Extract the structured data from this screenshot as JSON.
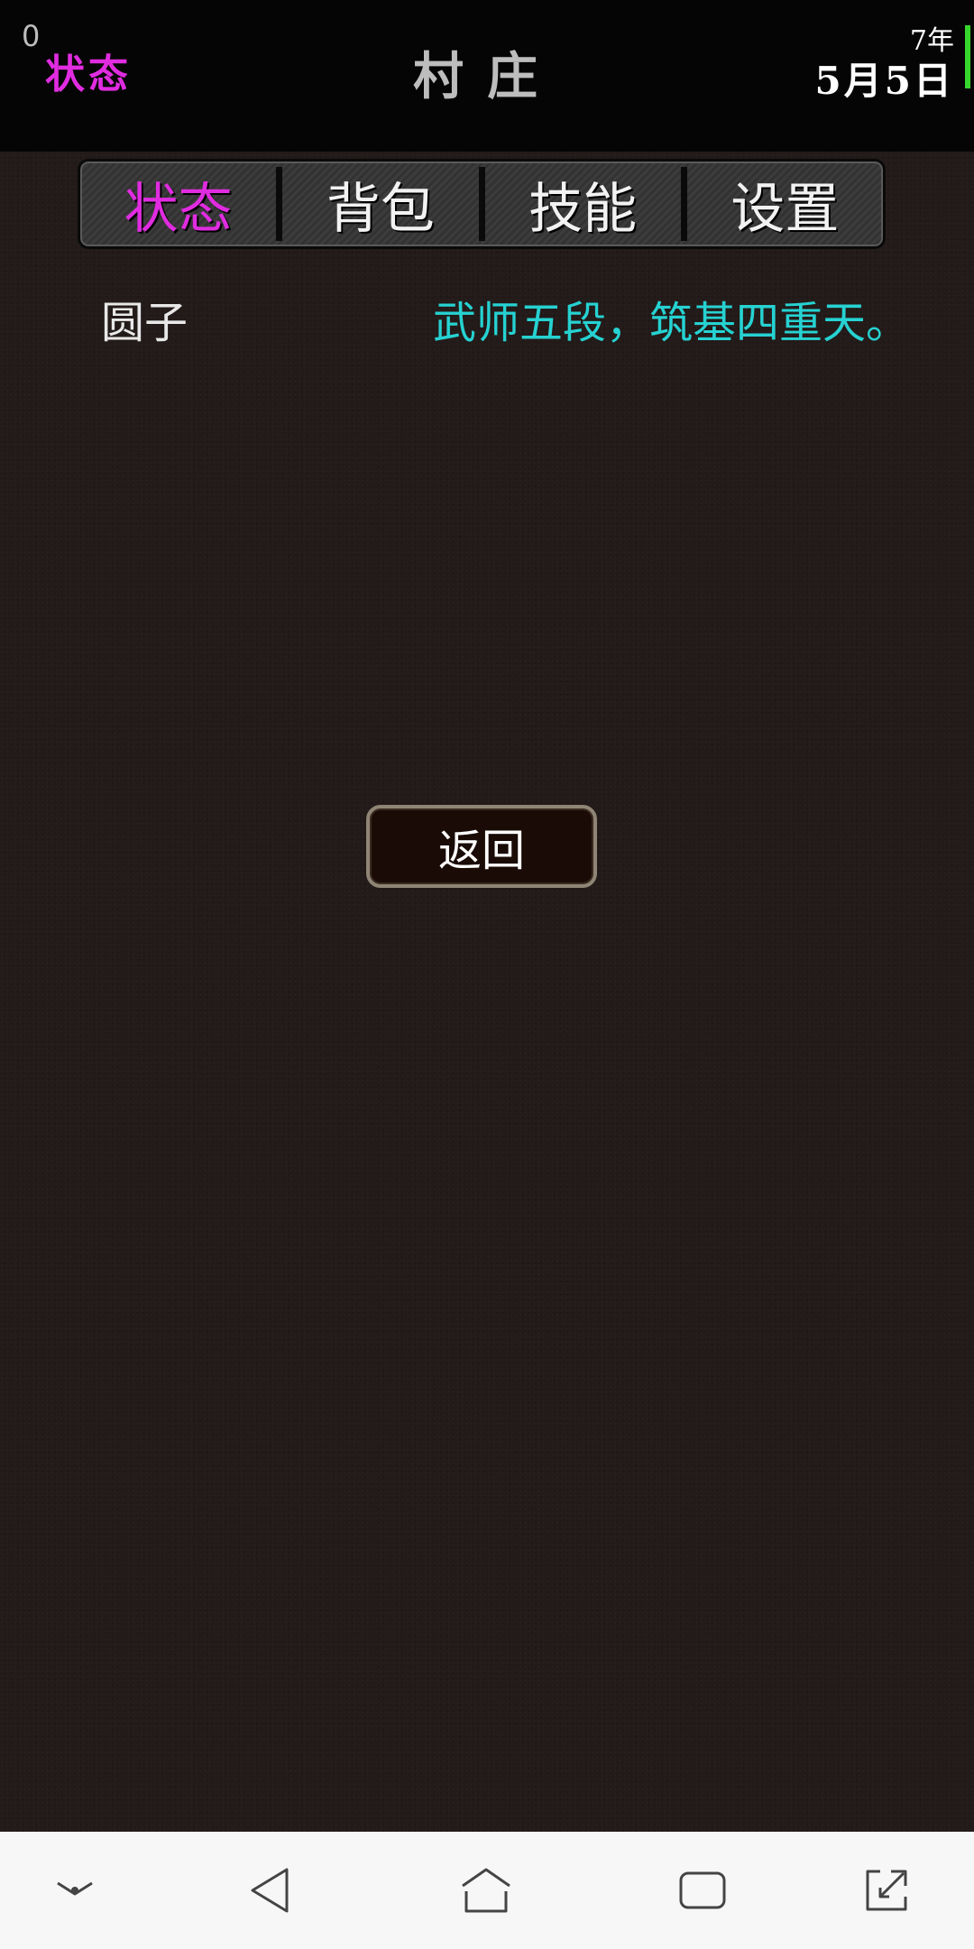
{
  "header": {
    "counter": "0",
    "status_label": "状态",
    "location": "村庄",
    "year": "7年",
    "date": "5月5日"
  },
  "tabs": [
    {
      "label": "状态",
      "active": true
    },
    {
      "label": "背包",
      "active": false
    },
    {
      "label": "技能",
      "active": false
    },
    {
      "label": "设置",
      "active": false
    }
  ],
  "character": {
    "name": "圆子",
    "rank": "武师五段，筑基四重天。"
  },
  "back_button": {
    "label": "返回"
  },
  "colors": {
    "accent_magenta": "#e02ce0",
    "rank_cyan": "#26d2d2",
    "energy_green": "#37d62c"
  },
  "navbar": {
    "icons": [
      "collapse-icon",
      "back-icon",
      "home-icon",
      "recents-icon",
      "fullscreen-icon"
    ]
  }
}
